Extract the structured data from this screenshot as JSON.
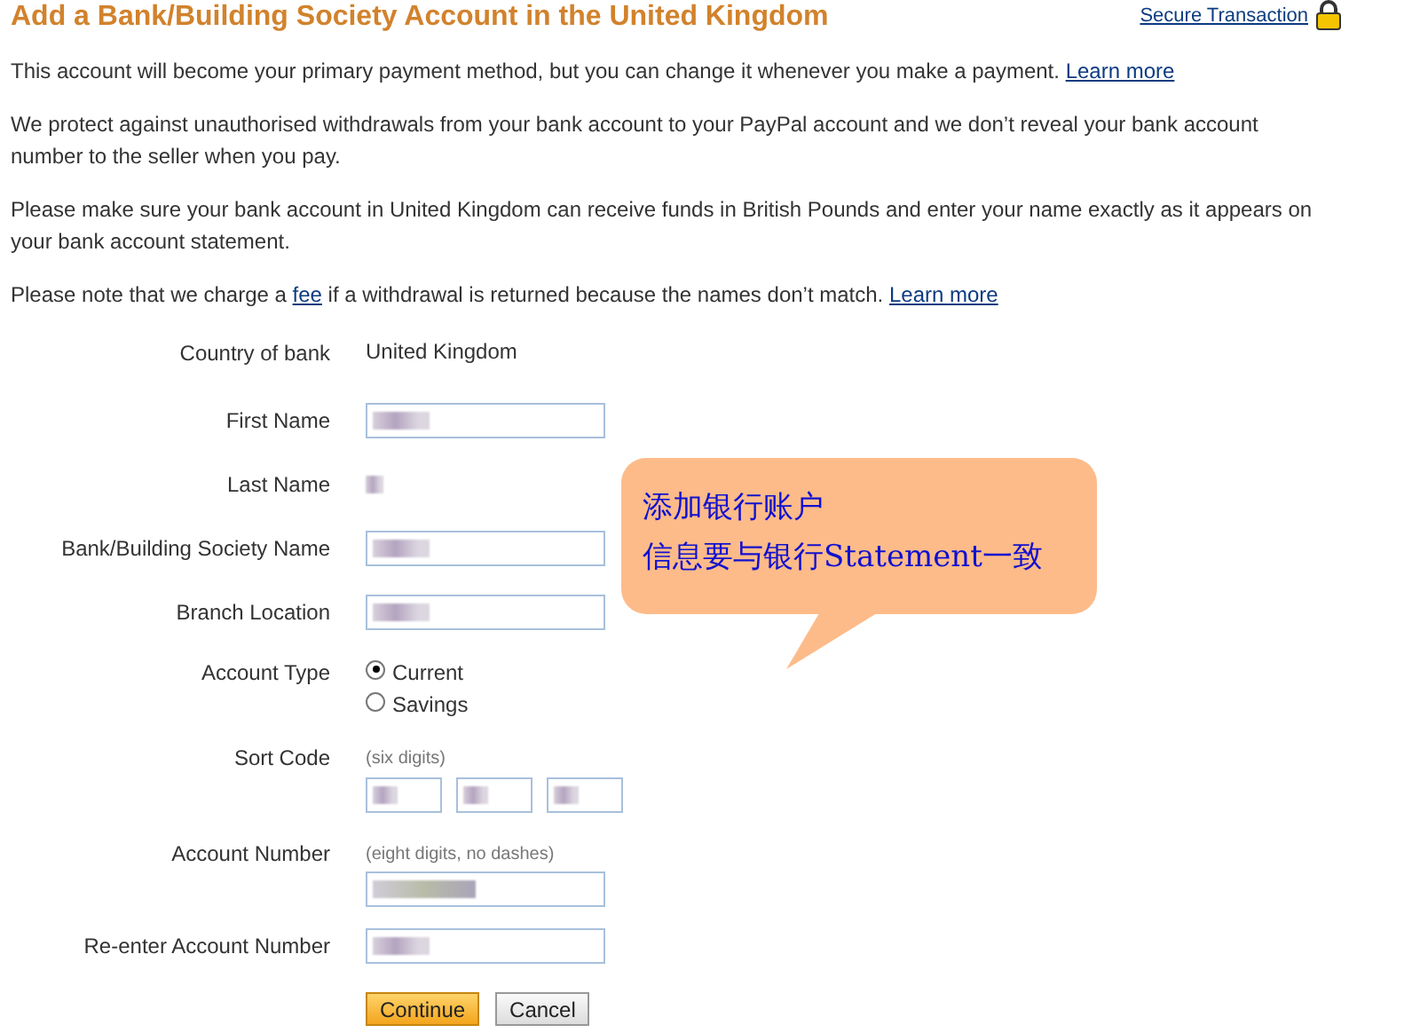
{
  "title": "Add a Bank/Building Society Account in the United Kingdom",
  "secure_link": "Secure Transaction",
  "paragraphs": [
    {
      "text": "This account will become your primary payment method, but you can change it whenever you make a payment.",
      "link": "Learn more"
    },
    {
      "text": "We protect against unauthorised withdrawals from your bank account to your PayPal account and we don’t reveal your bank account number to the seller when you pay."
    },
    {
      "text": "Please make sure your bank account in United Kingdom can receive funds in British Pounds and enter your name exactly as it appears on your bank account statement."
    },
    {
      "before": "Please note that we charge a",
      "inline_link": "fee",
      "after": "if a withdrawal is returned because the names don’t match.",
      "link": "Learn more"
    }
  ],
  "form": [
    {
      "kind": "static",
      "label": "Country of bank",
      "value": "United Kingdom"
    },
    {
      "kind": "field",
      "label": "First Name"
    },
    {
      "kind": "blurred",
      "label": "Last Name"
    },
    {
      "kind": "field",
      "label": "Bank/Building Society Name"
    },
    {
      "kind": "field",
      "label": "Branch Location"
    },
    {
      "kind": "radio",
      "label": "Account Type",
      "options": [
        {
          "label": "Current",
          "selected": true
        },
        {
          "label": "Savings",
          "selected": false
        }
      ]
    },
    {
      "kind": "sortcode",
      "label": "Sort Code",
      "hint": "(six digits)"
    },
    {
      "kind": "hinted",
      "label": "Account Number",
      "hint": "(eight digits, no dashes)"
    },
    {
      "kind": "field",
      "label": "Re-enter Account Number"
    }
  ],
  "buttons": [
    {
      "label": "Continue",
      "primary": true
    },
    {
      "label": "Cancel",
      "primary": false
    }
  ],
  "callout": {
    "lines": [
      "添加银行账户",
      "信息要与银行Statement一致"
    ]
  }
}
